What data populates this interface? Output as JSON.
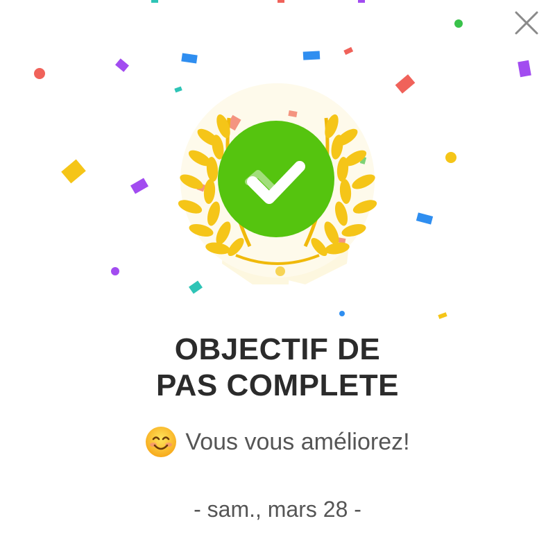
{
  "dialog": {
    "title_line_1": "OBJECTIF DE",
    "title_line_2": "PAS COMPLETE",
    "message": "Vous vous améliorez!",
    "date": "- sam., mars 28 -",
    "emoji": "smiling-face",
    "close_icon": "close-icon",
    "badge_icon": "checkmark-laurel-badge"
  },
  "colors": {
    "accent_green": "#55c40f",
    "laurel_gold": "#f5c518",
    "title_text": "#2b2b2b",
    "body_text": "#555555"
  }
}
